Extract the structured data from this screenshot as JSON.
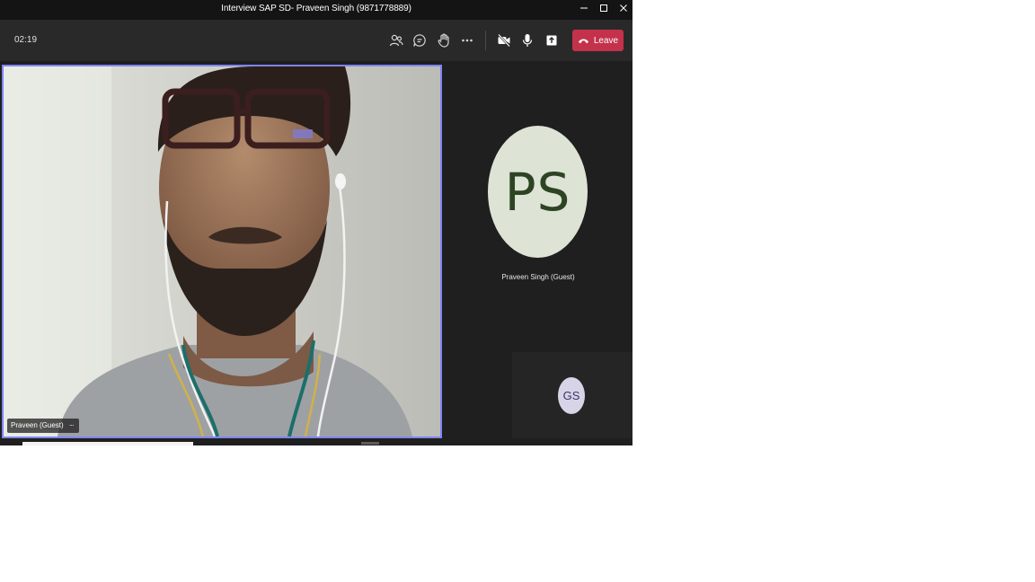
{
  "window": {
    "title": "Interview SAP SD- Praveen Singh (9871778889)",
    "controls": [
      "minimize-icon",
      "maximize-icon",
      "close-icon"
    ]
  },
  "toolbar": {
    "timer": "02:19",
    "buttons": [
      "people-icon",
      "chat-icon",
      "raise-hand-icon",
      "more-options-icon",
      "camera-off-icon",
      "microphone-icon",
      "share-screen-icon"
    ],
    "leave_label": "Leave",
    "leave_color": "#c4314b"
  },
  "main_video": {
    "name_label": "Praveen (Guest)",
    "more_label": "···",
    "highlight_color": "#7f85f5"
  },
  "participant": {
    "initials": "PS",
    "name": "Praveen Singh (Guest)",
    "avatar_color": "#dde3d5"
  },
  "self_view": {
    "initials": "GS",
    "avatar_color": "#d8d4e8"
  }
}
